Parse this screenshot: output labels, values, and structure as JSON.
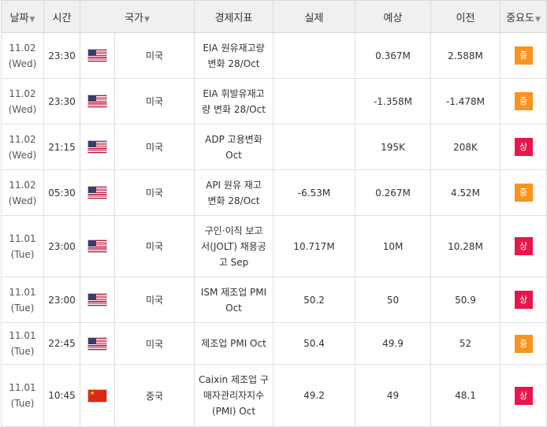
{
  "headers": {
    "date": "날짜",
    "time": "시간",
    "country": "국가",
    "indicator": "경제지표",
    "actual": "실제",
    "forecast": "예상",
    "previous": "이전",
    "importance": "중요도",
    "sort_glyph": "▼"
  },
  "rows": [
    {
      "date": "11.02",
      "day": "(Wed)",
      "time": "23:30",
      "flag": "us",
      "country": "미국",
      "indicator": [
        "EIA 원유재고량",
        "변화 28/Oct"
      ],
      "actual": "",
      "forecast": "0.367M",
      "previous": "2.588M",
      "importance": "중",
      "level": "mid"
    },
    {
      "date": "11.02",
      "day": "(Wed)",
      "time": "23:30",
      "flag": "us",
      "country": "미국",
      "indicator": [
        "EIA 휘발유재고",
        "량 변화 28/Oct"
      ],
      "actual": "",
      "forecast": "-1.358M",
      "previous": "-1.478M",
      "importance": "중",
      "level": "mid"
    },
    {
      "date": "11.02",
      "day": "(Wed)",
      "time": "21:15",
      "flag": "us",
      "country": "미국",
      "indicator": [
        "ADP 고용변화",
        "Oct"
      ],
      "actual": "",
      "forecast": "195K",
      "previous": "208K",
      "importance": "상",
      "level": "high"
    },
    {
      "date": "11.02",
      "day": "(Wed)",
      "time": "05:30",
      "flag": "us",
      "country": "미국",
      "indicator": [
        "API 원유 재고",
        "변화 28/Oct"
      ],
      "actual": "-6.53M",
      "forecast": "0.267M",
      "previous": "4.52M",
      "importance": "중",
      "level": "mid"
    },
    {
      "date": "11.01",
      "day": "(Tue)",
      "time": "23:00",
      "flag": "us",
      "country": "미국",
      "indicator": [
        "구인·이직 보고",
        "서(JOLT) 채용공",
        "고 Sep"
      ],
      "actual": "10.717M",
      "forecast": "10M",
      "previous": "10.28M",
      "importance": "상",
      "level": "high"
    },
    {
      "date": "11.01",
      "day": "(Tue)",
      "time": "23:00",
      "flag": "us",
      "country": "미국",
      "indicator": [
        "ISM 제조업 PMI",
        "Oct"
      ],
      "actual": "50.2",
      "forecast": "50",
      "previous": "50.9",
      "importance": "상",
      "level": "high"
    },
    {
      "date": "11.01",
      "day": "(Tue)",
      "time": "22:45",
      "flag": "us",
      "country": "미국",
      "indicator": [
        "제조업 PMI Oct"
      ],
      "actual": "50.4",
      "forecast": "49.9",
      "previous": "52",
      "importance": "중",
      "level": "mid"
    },
    {
      "date": "11.01",
      "day": "(Tue)",
      "time": "10:45",
      "flag": "cn",
      "country": "중국",
      "indicator": [
        "Caixin 제조업 구",
        "매자관리자지수",
        "(PMI) Oct"
      ],
      "actual": "49.2",
      "forecast": "49",
      "previous": "48.1",
      "importance": "상",
      "level": "high"
    }
  ],
  "colors": {
    "mid": "#f7941d",
    "high": "#e8174b",
    "header_bg": "#f0f0f0"
  },
  "icons": {
    "us": "us-flag-icon",
    "cn": "china-flag-icon"
  }
}
